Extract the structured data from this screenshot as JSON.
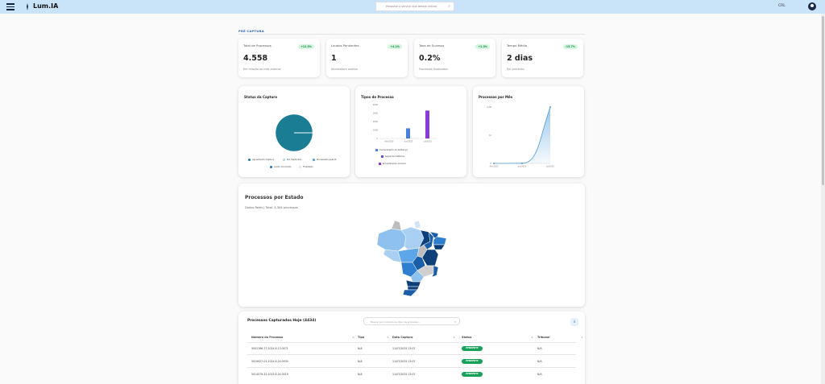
{
  "header": {
    "brand": "Lum.IA",
    "search_placeholder": "Pesquise o serviço que deseja utilizar",
    "org": "CRL"
  },
  "section_title": "PRÉ CAPTURA",
  "kpis": [
    {
      "label": "Total de Processos",
      "badge": "+12.5%",
      "value": "4.558",
      "sub": "Em relação ao mês anterior"
    },
    {
      "label": "Laudos Pendentes",
      "badge": "+4.1%",
      "value": "1",
      "sub": "Necessitam análise"
    },
    {
      "label": "Taxa de Sucesso",
      "badge": "+2.3%",
      "value": "0.2%",
      "sub": "Processos finalizados"
    },
    {
      "label": "Tempo Médio",
      "badge": "-15.7%",
      "value": "2 dias",
      "sub": "Por processo"
    }
  ],
  "charts": {
    "status_title": "Status da Captura",
    "tipos_title": "Tipos de Processo",
    "mes_title": "Processos por Mês"
  },
  "chart_data": [
    {
      "type": "pie",
      "title": "Status da Captura",
      "labels": [
        "Aguardando Captura",
        "Pré Capturado",
        "Processado pela IA",
        "Laudo Concluído",
        "Finalizado"
      ],
      "values": [
        99.8,
        0.05,
        0.05,
        0.05,
        0.05
      ],
      "colors": [
        "#1a7d94",
        "#b7d3e0",
        "#4b9ad8",
        "#1e6fbf",
        "#d7e7f2"
      ],
      "legend": "bottom"
    },
    {
      "type": "bar",
      "title": "Tipos de Processo",
      "categories": [
        "Abr/2025",
        "Jun/2025",
        "Jul/2025"
      ],
      "series": [
        {
          "name": "Cumprimento de Sentença",
          "values": [
            0,
            1200,
            0
          ],
          "color": "#4a7fe0"
        },
        {
          "name": "Segunda Instância",
          "values": [
            0,
            0,
            0
          ],
          "color": "#6b4fe0"
        },
        {
          "name": "Procedimento Comum",
          "values": [
            0,
            0,
            3300
          ],
          "color": "#8b38d8"
        }
      ],
      "yticks": [
        "4000",
        "3000",
        "2000",
        "1000",
        "0"
      ],
      "ylim": [
        0,
        4000
      ],
      "legend": "bottom"
    },
    {
      "type": "area",
      "title": "Processos por Mês",
      "categories": [
        "Abr/2025",
        "Jun/2025",
        "Jul/2025"
      ],
      "values": [
        0,
        10,
        4300
      ],
      "yticks": [
        "4.3M",
        "1k",
        "0"
      ],
      "color": "#4b9ad8"
    }
  ],
  "map": {
    "title": "Processos por Estado",
    "subtitle": "Dados Reais | Total: 4.344 processos"
  },
  "table": {
    "title": "Processos Capturados Hoje (4434)",
    "search_placeholder": "Buscar por número ou tipo de processo...",
    "columns": [
      "Número do Processo",
      "Tipo",
      "Data Captura",
      "Status",
      "Tribunal"
    ],
    "rows": [
      {
        "numero": "5052766-77.2024.8.13.0471",
        "tipo": "N/A",
        "data": "11/07/2025 13:07",
        "status": "PENDENTE",
        "tribunal": "N/A"
      },
      {
        "numero": "5019927-01.2024.8.24.0930",
        "tipo": "N/A",
        "data": "11/07/2025 13:07",
        "status": "PENDENTE",
        "tribunal": "N/A"
      },
      {
        "numero": "5014579-32.2025.8.24.0019",
        "tipo": "N/A",
        "data": "11/07/2025 13:07",
        "status": "PENDENTE",
        "tribunal": "N/A"
      }
    ]
  }
}
